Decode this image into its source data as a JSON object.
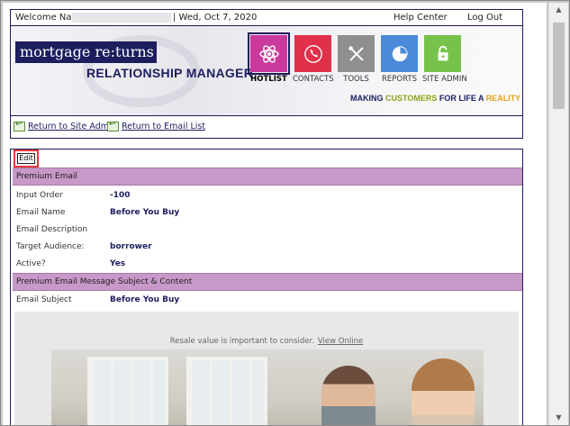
{
  "topbar": {
    "welcome": "Welcome Natalie",
    "date": "| Wed, Oct 7, 2020",
    "help": "Help Center",
    "logout": "Log Out"
  },
  "banner": {
    "logo": "mortgage re:turns",
    "subtitle": "RELATIONSHIP MANAGER",
    "tagline_pre": "MAKING ",
    "tagline_customers": "CUSTOMERS",
    "tagline_mid": " FOR LIFE A ",
    "tagline_reality": "REALITY",
    "colors": {
      "navy": "#1c1e5e",
      "green": "#8aa61b",
      "gold": "#e0a21a"
    }
  },
  "nav": [
    {
      "label": "HOTLIST",
      "icon": "atom-icon",
      "color": "#c93a9c",
      "active": true
    },
    {
      "label": "CONTACTS",
      "icon": "phone-icon",
      "color": "#e0304a",
      "active": false
    },
    {
      "label": "TOOLS",
      "icon": "tools-icon",
      "color": "#8f8f8f",
      "active": false
    },
    {
      "label": "REPORTS",
      "icon": "pie-chart-icon",
      "color": "#4a8ad8",
      "active": false
    },
    {
      "label": "SITE ADMIN",
      "icon": "lock-icon",
      "color": "#76c24a",
      "active": false
    }
  ],
  "links": {
    "site_admin": "Return to Site Admin",
    "email_list": "Return to Email List"
  },
  "edit_label": "Edit",
  "sections": {
    "premium_email": "Premium Email",
    "message": "Premium Email Message Subject & Content"
  },
  "fields": [
    {
      "label": "Input Order",
      "value": "-100"
    },
    {
      "label": "Email Name",
      "value": "Before You Buy"
    },
    {
      "label": "Email Description",
      "value": ""
    },
    {
      "label": "Target Audience:",
      "value": "borrower"
    },
    {
      "label": "Active?",
      "value": "Yes"
    }
  ],
  "subject": {
    "label": "Email Subject",
    "value": "Before You Buy"
  },
  "preview": {
    "text": "Resale value is important to consider.",
    "link": "View Online"
  }
}
